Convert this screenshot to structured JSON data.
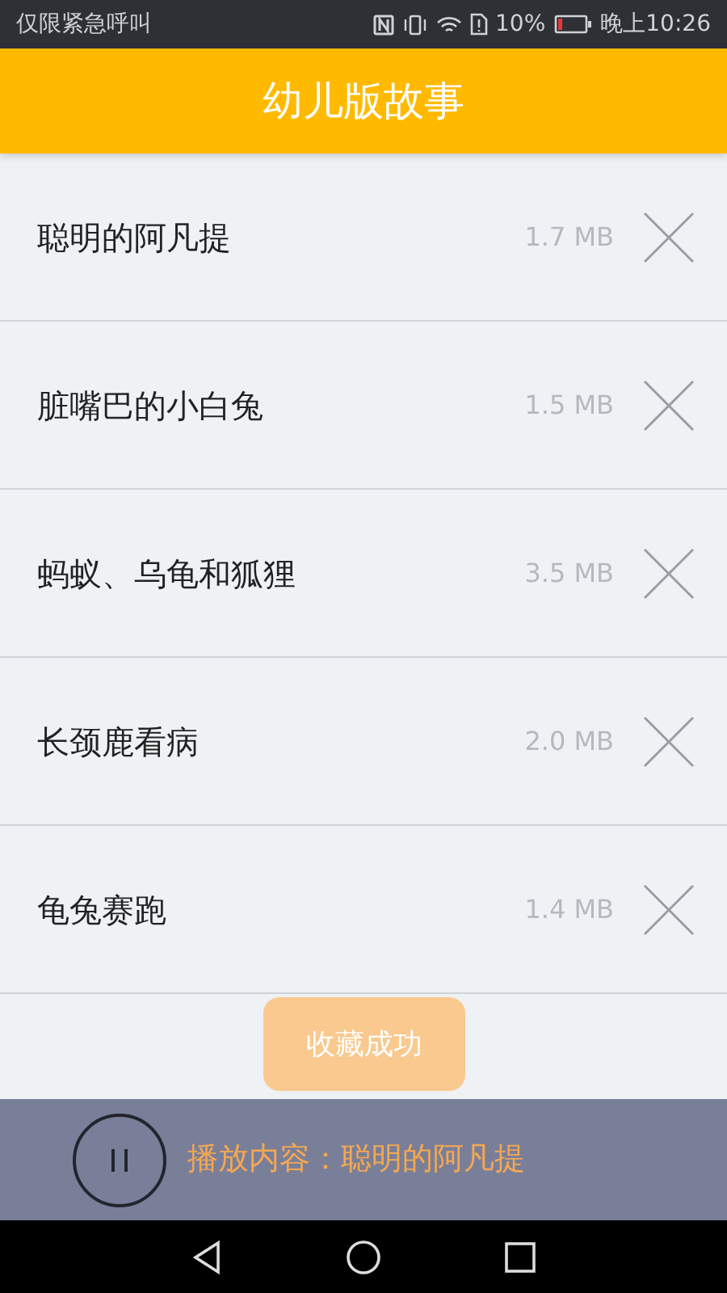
{
  "status_bar": {
    "carrier": "仅限紧急呼叫",
    "battery_percent": "10%",
    "time": "晚上10:26"
  },
  "header": {
    "title": "幼儿版故事"
  },
  "stories": [
    {
      "title": "聪明的阿凡提",
      "size": "1.7 MB"
    },
    {
      "title": "脏嘴巴的小白兔",
      "size": "1.5 MB"
    },
    {
      "title": "蚂蚁、乌龟和狐狸",
      "size": "3.5 MB"
    },
    {
      "title": "长颈鹿看病",
      "size": "2.0 MB"
    },
    {
      "title": "龟兔赛跑",
      "size": "1.4 MB"
    }
  ],
  "toast": "收藏成功",
  "player": {
    "now_playing": "播放内容：聪明的阿凡提"
  }
}
